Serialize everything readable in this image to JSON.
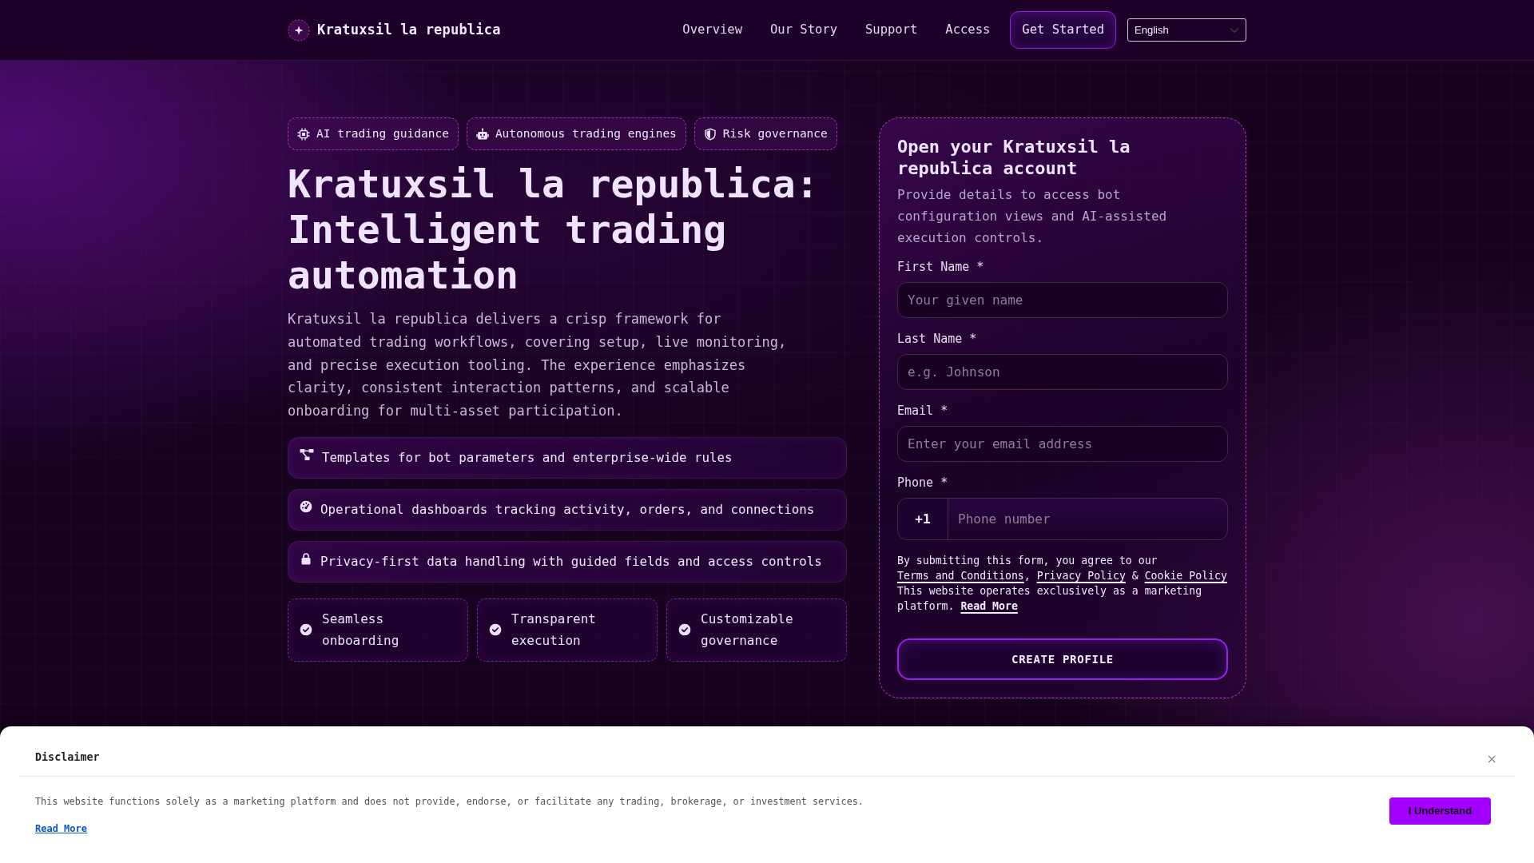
{
  "header": {
    "brand": "Kratuxsil la republica",
    "nav": [
      {
        "label": "Overview"
      },
      {
        "label": "Our Story"
      },
      {
        "label": "Support"
      },
      {
        "label": "Access"
      }
    ],
    "cta": "Get Started",
    "language": "English"
  },
  "hero": {
    "badges": [
      {
        "kind": "chip",
        "label": "AI trading guidance"
      },
      {
        "kind": "robot",
        "label": "Autonomous trading engines"
      },
      {
        "kind": "shield",
        "label": "Risk governance"
      }
    ],
    "title": "Kratuxsil la republica: Intelligent trading automation",
    "description": "Kratuxsil la republica delivers a crisp framework for automated trading workflows, covering setup, live monitoring, and precise execution tooling. The experience emphasizes clarity, consistent interaction patterns, and scalable onboarding for multi-asset participation.",
    "features": [
      {
        "kind": "nodes",
        "text": "Templates for bot parameters and enterprise-wide rules"
      },
      {
        "kind": "gauge",
        "text": "Operational dashboards tracking activity, orders, and connections"
      },
      {
        "kind": "lock",
        "text": "Privacy-first data handling with guided fields and access controls"
      }
    ],
    "highlights": [
      {
        "text": "Seamless onboarding"
      },
      {
        "text": "Transparent execution"
      },
      {
        "text": "Customizable governance"
      }
    ]
  },
  "signup": {
    "title": "Open your Kratuxsil la republica account",
    "subtitle": "Provide details to access bot configuration views and AI-assisted execution controls.",
    "fields": [
      {
        "kind": "text",
        "label": "First Name *",
        "placeholder": "Your given name"
      },
      {
        "kind": "text",
        "label": "Last Name *",
        "placeholder": "e.g. Johnson"
      },
      {
        "kind": "email",
        "label": "Email *",
        "placeholder": "Enter your email address"
      },
      {
        "kind": "phone",
        "label": "Phone *",
        "prefix": "+1",
        "placeholder": "Phone number"
      }
    ],
    "consent": [
      {
        "kind": "text",
        "text": "By submitting this form, you agree to our "
      },
      {
        "kind": "link",
        "text": "Terms and Conditions"
      },
      {
        "kind": "text",
        "text": ", "
      },
      {
        "kind": "link",
        "text": "Privacy Policy"
      },
      {
        "kind": "text",
        "text": " & "
      },
      {
        "kind": "link",
        "text": "Cookie Policy"
      }
    ],
    "notice": {
      "text": "This website operates exclusively as a marketing platform.",
      "link": "Read More"
    },
    "submit": "CREATE PROFILE"
  },
  "disclaimer": {
    "title": "Disclaimer",
    "close": "×",
    "text": "This website functions solely as a marketing platform and does not provide, endorse, or facilitate any trading, brokerage, or investment services.",
    "link": "Read More",
    "button": "I Understand"
  }
}
